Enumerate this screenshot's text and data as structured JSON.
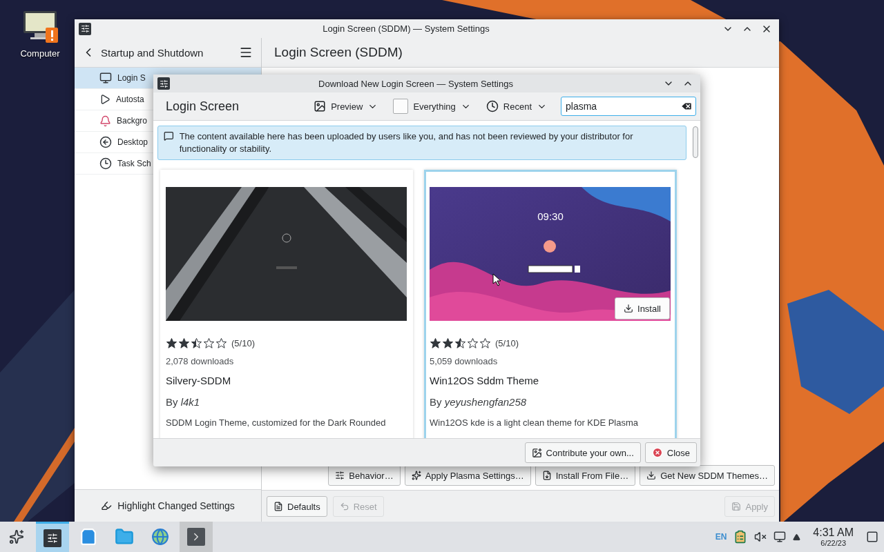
{
  "desktop": {
    "icons": [
      {
        "label": "Computer"
      }
    ]
  },
  "main_window": {
    "title": "Login Screen (SDDM) — System Settings",
    "sidebar": {
      "heading": "Startup and Shutdown",
      "items": [
        {
          "label": "Login S",
          "selected": true
        },
        {
          "label": "Autosta",
          "selected": false
        },
        {
          "label": "Backgro",
          "selected": false
        },
        {
          "label": "Desktop",
          "selected": false
        },
        {
          "label": "Task Sch",
          "selected": false
        }
      ],
      "footer_button": "Highlight Changed Settings"
    },
    "page_title": "Login Screen (SDDM)",
    "action_buttons": [
      {
        "kind": "behavior",
        "label": "Behavior…"
      },
      {
        "kind": "apply-plasma",
        "label": "Apply Plasma Settings…"
      },
      {
        "kind": "install-file",
        "label": "Install From File…"
      },
      {
        "kind": "get-new",
        "label": "Get New SDDM Themes…"
      }
    ],
    "footer_buttons": [
      {
        "kind": "defaults",
        "label": "Defaults",
        "disabled": false
      },
      {
        "kind": "reset",
        "label": "Reset",
        "disabled": true
      },
      {
        "kind": "apply",
        "label": "Apply",
        "disabled": true
      }
    ]
  },
  "dialog": {
    "title": "Download New Login Screen — System Settings",
    "heading": "Login Screen",
    "filters": [
      {
        "kind": "view",
        "label": "Preview"
      },
      {
        "kind": "category",
        "label": "Everything"
      },
      {
        "kind": "sort",
        "label": "Recent"
      }
    ],
    "search": {
      "value": "plasma"
    },
    "notice": "The content available here has been uploaded by users like you, and has not been reviewed by your distributor for functionality or stability.",
    "cards": [
      {
        "kind": "dark",
        "selected": false,
        "stars": 2.5,
        "rating": "(5/10)",
        "downloads": "2,078 downloads",
        "name": "Silvery-SDDM",
        "author": "By *l4k1*",
        "description": "SDDM Login Theme, customized for the Dark Rounded"
      },
      {
        "kind": "purple",
        "selected": true,
        "preview_clock": "09:30",
        "install": "Install",
        "stars": 2.5,
        "rating": "(5/10)",
        "downloads": "5,059 downloads",
        "name": "Win12OS Sddm Theme",
        "author": "By *yeyushengfan258*",
        "description": "Win12OS kde is a light clean theme for KDE Plasma"
      }
    ],
    "footer_buttons": [
      {
        "kind": "contribute",
        "label": "Contribute your own..."
      },
      {
        "kind": "close",
        "label": "Close"
      }
    ]
  },
  "taskbar": {
    "tasks": [
      {
        "kind": "settings",
        "selected": true,
        "hovered": false
      },
      {
        "kind": "store",
        "selected": false,
        "hovered": false
      },
      {
        "kind": "files",
        "selected": false,
        "hovered": false
      },
      {
        "kind": "browser",
        "selected": false,
        "hovered": false
      },
      {
        "kind": "terminal",
        "selected": false,
        "hovered": true
      }
    ],
    "language": "EN",
    "time": "4:31 AM",
    "date": "6/22/23"
  }
}
